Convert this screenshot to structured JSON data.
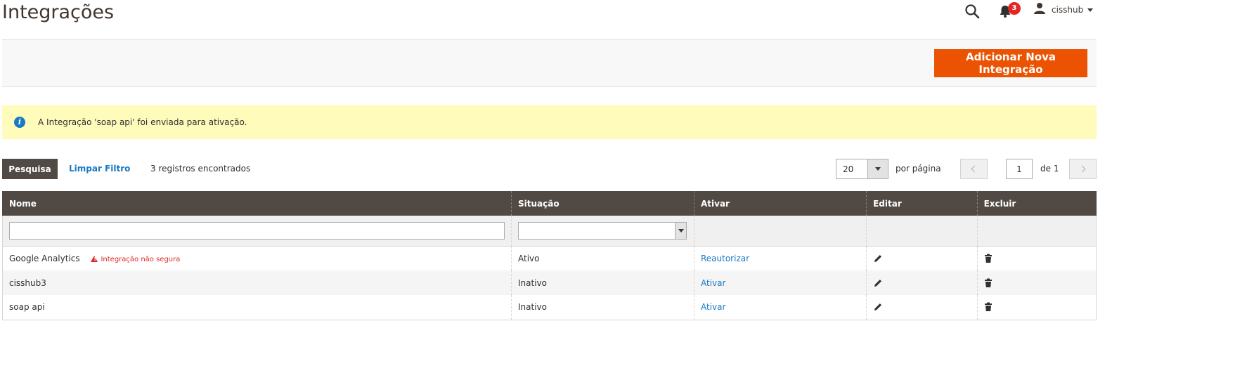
{
  "page": {
    "title": "Integrações"
  },
  "header": {
    "notifications_count": "3",
    "user_name": "cisshub",
    "icons": {
      "search": "search-icon",
      "notifications": "bell-icon",
      "user": "user-icon"
    }
  },
  "actions": {
    "add_label": "Adicionar Nova Integração"
  },
  "message": {
    "text": "A Integração 'soap api' foi enviada para ativação."
  },
  "toolbar": {
    "search_label": "Pesquisa",
    "reset_label": "Limpar Filtro",
    "records": "3 registros encontrados"
  },
  "pager": {
    "per_page_value": "20",
    "per_page_label": "por página",
    "current_page": "1",
    "of_label": "de 1"
  },
  "grid": {
    "columns": [
      "Nome",
      "Situação",
      "Ativar",
      "Editar",
      "Excluir"
    ],
    "rows": [
      {
        "name": "Google Analytics",
        "warning": "Integração não segura",
        "status": "Ativo",
        "action": "Reautorizar"
      },
      {
        "name": "cisshub3",
        "warning": "",
        "status": "Inativo",
        "action": "Ativar"
      },
      {
        "name": "soap api",
        "warning": "",
        "status": "Inativo",
        "action": "Ativar"
      }
    ]
  },
  "colors": {
    "accent": "#eb5202",
    "header_bg": "#514943",
    "link": "#1979c3",
    "message_bg": "#fffbbb",
    "danger": "#e22626"
  }
}
